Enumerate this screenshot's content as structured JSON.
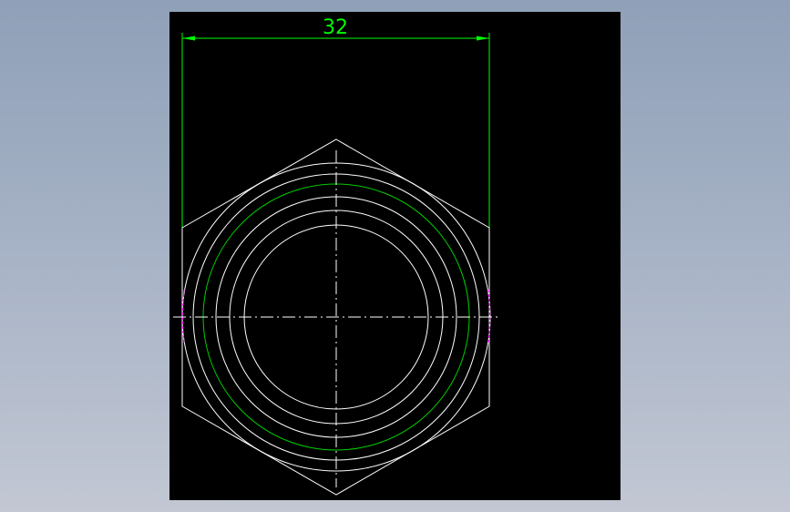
{
  "drawing": {
    "dimension_label": "32",
    "colors": {
      "background": "#000000",
      "geometry": "#ffffff",
      "dimension": "#00ff00",
      "thread_circle": "#00cc00",
      "centerline": "#ffffff",
      "hidden_marks": "#ff00ff"
    }
  }
}
